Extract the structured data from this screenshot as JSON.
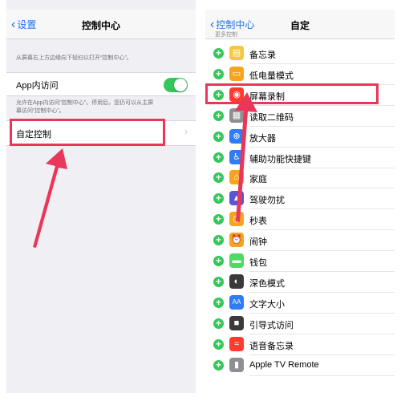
{
  "left": {
    "nav": {
      "back": "设置",
      "title": "控制中心"
    },
    "intro": "从屏幕右上方边缘向下轻扫以打开“控制中心”。",
    "app_access": {
      "label": "App内访问",
      "enabled": true
    },
    "app_access_desc_1": "允许在App内访问“控制中心”。停用后，您仍可以从主屏",
    "app_access_desc_2": "幕访问“控制中心”。",
    "customize": {
      "label": "自定控制"
    }
  },
  "right": {
    "nav": {
      "back": "控制中心",
      "title": "自定"
    },
    "section": "更多控制",
    "items": [
      {
        "label": "备忘录",
        "icon": "notes-icon",
        "color": "#f7c73d",
        "glyph": "▤"
      },
      {
        "label": "低电量模式",
        "icon": "battery-icon",
        "color": "#f7a41d",
        "glyph": "▭"
      },
      {
        "label": "屏幕录制",
        "icon": "screen-record-icon",
        "color": "#ff3b30",
        "glyph": "◉"
      },
      {
        "label": "读取二维码",
        "icon": "qr-code-icon",
        "color": "#8e8e93",
        "glyph": "▦"
      },
      {
        "label": "放大器",
        "icon": "magnifier-icon",
        "color": "#2f7cf6",
        "glyph": "⊕"
      },
      {
        "label": "辅助功能快捷键",
        "icon": "accessibility-icon",
        "color": "#2f7cf6",
        "glyph": "♿"
      },
      {
        "label": "家庭",
        "icon": "home-icon",
        "color": "#f7a41d",
        "glyph": "⌂"
      },
      {
        "label": "驾驶勿扰",
        "icon": "car-icon",
        "color": "#5856d6",
        "glyph": "▲"
      },
      {
        "label": "秒表",
        "icon": "stopwatch-icon",
        "color": "#f7a41d",
        "glyph": "◷"
      },
      {
        "label": "闹钟",
        "icon": "alarm-icon",
        "color": "#f7a41d",
        "glyph": "⏰"
      },
      {
        "label": "钱包",
        "icon": "wallet-icon",
        "color": "#4cd964",
        "glyph": "▬"
      },
      {
        "label": "深色模式",
        "icon": "dark-mode-icon",
        "color": "#3a3a3c",
        "glyph": "◐"
      },
      {
        "label": "文字大小",
        "icon": "text-size-icon",
        "color": "#2f7cf6",
        "glyph": "AA"
      },
      {
        "label": "引导式访问",
        "icon": "lock-icon",
        "color": "#3a3a3c",
        "glyph": "■"
      },
      {
        "label": "语音备忘录",
        "icon": "voice-memo-icon",
        "color": "#ff3b30",
        "glyph": "≈"
      },
      {
        "label": "Apple TV Remote",
        "icon": "remote-icon",
        "color": "#8e8e93",
        "glyph": "▮"
      }
    ]
  },
  "colors": {
    "accent": "#1a73e8",
    "toggle_on": "#34c759",
    "highlight": "#ea3659"
  }
}
